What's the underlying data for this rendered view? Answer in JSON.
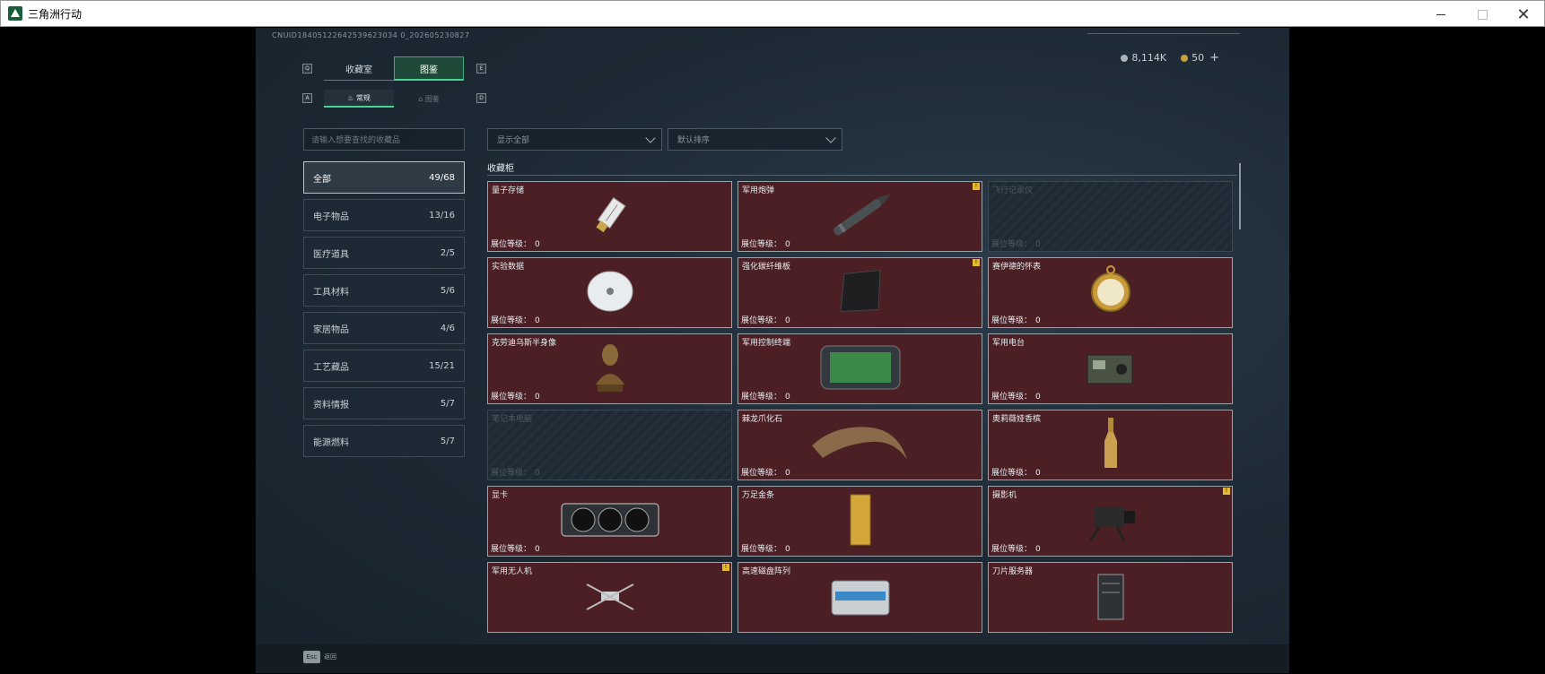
{
  "window": {
    "title": "三角洲行动"
  },
  "header": {
    "uid": "CNUID18405122642539623034 0_202605230827",
    "silver": "8,114K",
    "gold": "50",
    "plus": "+"
  },
  "tabs": [
    {
      "label": "收藏室"
    },
    {
      "label": "图鉴"
    }
  ],
  "subtabs": [
    {
      "label": "常规"
    },
    {
      "label": "图鉴"
    }
  ],
  "keys": {
    "q": "Q",
    "e": "E",
    "a": "A",
    "d": "D"
  },
  "search": {
    "placeholder": "请输入想要查找的收藏品"
  },
  "filters": {
    "show": "显示全部",
    "sort": "默认排序"
  },
  "section_title": "收藏柜",
  "categories": [
    {
      "label": "全部",
      "count": "49/68"
    },
    {
      "label": "电子物品",
      "count": "13/16"
    },
    {
      "label": "医疗道具",
      "count": "2/5"
    },
    {
      "label": "工具材料",
      "count": "5/6"
    },
    {
      "label": "家居物品",
      "count": "4/6"
    },
    {
      "label": "工艺藏品",
      "count": "15/21"
    },
    {
      "label": "资料情报",
      "count": "5/7"
    },
    {
      "label": "能源燃料",
      "count": "5/7"
    }
  ],
  "level_label": "展位等级：",
  "items": [
    {
      "name": "量子存储",
      "level": "0",
      "icon": "usb-drive-icon"
    },
    {
      "name": "军用炮弹",
      "level": "0",
      "icon": "shell-icon",
      "badge": "!"
    },
    {
      "name": "飞行记录仪",
      "level": "0",
      "icon": "flight-recorder-icon"
    },
    {
      "name": "实验数据",
      "level": "0",
      "icon": "disc-icon"
    },
    {
      "name": "强化碳纤维板",
      "level": "0",
      "icon": "carbon-plate-icon",
      "badge": "!"
    },
    {
      "name": "赛伊德的怀表",
      "level": "0",
      "icon": "pocket-watch-icon"
    },
    {
      "name": "克劳迪乌斯半身像",
      "level": "0",
      "icon": "bust-icon"
    },
    {
      "name": "军用控制终端",
      "level": "0",
      "icon": "terminal-icon"
    },
    {
      "name": "军用电台",
      "level": "0",
      "icon": "radio-icon"
    },
    {
      "name": "笔记本电脑",
      "level": "0",
      "icon": "laptop-icon"
    },
    {
      "name": "棘龙爪化石",
      "level": "0",
      "icon": "claw-fossil-icon"
    },
    {
      "name": "奥莉薇娅香槟",
      "level": "0",
      "icon": "champagne-icon"
    },
    {
      "name": "显卡",
      "level": "0",
      "icon": "gpu-icon"
    },
    {
      "name": "万足金条",
      "level": "0",
      "icon": "gold-bar-icon"
    },
    {
      "name": "摄影机",
      "level": "0",
      "icon": "camera-icon",
      "badge": "!"
    },
    {
      "name": "军用无人机",
      "level": "",
      "icon": "drone-icon",
      "badge": "!"
    },
    {
      "name": "高速磁盘阵列",
      "level": "",
      "icon": "disk-array-icon"
    },
    {
      "name": "刀片服务器",
      "level": "",
      "icon": "server-icon"
    }
  ],
  "footer": {
    "esc_key": "Esc",
    "esc_label": "返回"
  }
}
